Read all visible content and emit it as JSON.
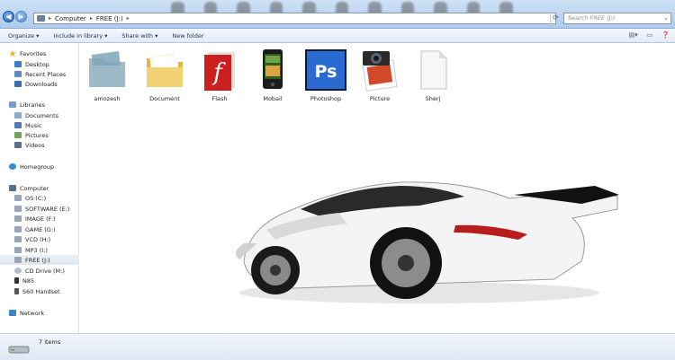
{
  "window": {
    "breadcrumb": [
      "Computer",
      "FREE (J:)"
    ],
    "search_placeholder": "Search FREE (J:)"
  },
  "toolbar": {
    "organize": "Organize ▾",
    "include": "Include in library ▾",
    "share": "Share with ▾",
    "new_folder": "New folder"
  },
  "sidebar": {
    "favorites": "Favorites",
    "favorites_items": [
      "Desktop",
      "Recent Places",
      "Downloads"
    ],
    "libraries": "Libraries",
    "libraries_items": [
      "Documents",
      "Music",
      "Pictures",
      "Videos"
    ],
    "homegroup": "Homegroup",
    "computer": "Computer",
    "computer_items": [
      "OS (C:)",
      "SOFTWARE (E:)",
      "IMAGE (F:)",
      "GAME (G:)",
      "VCD (H:)",
      "MP3 (I:)",
      "FREE (J:)",
      "CD Drive (M:)",
      "N85",
      "S60 Handset"
    ],
    "network": "Network",
    "selected": "FREE (J:)"
  },
  "files": [
    {
      "name": "amozesh",
      "icon": "folder-icon"
    },
    {
      "name": "Document",
      "icon": "folder-icon"
    },
    {
      "name": "Flash",
      "icon": "flash-icon"
    },
    {
      "name": "Mobail",
      "icon": "phone-icon"
    },
    {
      "name": "Photoshop",
      "icon": "photoshop-icon"
    },
    {
      "name": "Picture",
      "icon": "pictures-icon"
    },
    {
      "name": "Sherj",
      "icon": "document-icon"
    }
  ],
  "status": {
    "item_count": "7 items"
  },
  "colors": {
    "titlebar": "#b9d4f1",
    "accent": "#1f5fb4",
    "selection": "#dfe7f0"
  }
}
